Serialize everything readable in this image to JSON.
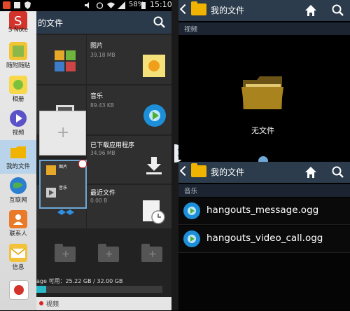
{
  "status_bar": {
    "battery": "58%",
    "time": "15:10"
  },
  "sidebar": {
    "items": [
      {
        "label": "S Note"
      },
      {
        "label": "随附随贴"
      },
      {
        "label": "相册"
      },
      {
        "label": "视频"
      },
      {
        "label": "我的文件",
        "selected": true
      },
      {
        "label": "互联网"
      },
      {
        "label": "联系人"
      },
      {
        "label": "信息"
      }
    ]
  },
  "left_panel": {
    "title": "的文件",
    "categories": [
      {
        "name": "图片",
        "size": "39.18 MB"
      },
      {
        "name": "音乐",
        "size": "89.43 KB"
      },
      {
        "name": "已下载应用程序",
        "size": "34.96 MB"
      },
      {
        "name": "最近文件",
        "size": "0.00 B"
      }
    ],
    "drag_preview": {
      "line1": "图片",
      "line2": "音乐"
    },
    "storage_text": "age 可用：25.22 GB / 32.00 GB",
    "bottom_label": "视频"
  },
  "top_panel": {
    "title": "我的文件",
    "section": "视频",
    "empty_text": "无文件"
  },
  "bottom_panel": {
    "title": "我的文件",
    "section": "音乐",
    "files": [
      {
        "name": "hangouts_message.ogg"
      },
      {
        "name": "hangouts_video_call.ogg"
      }
    ]
  },
  "colors": {
    "accent": "#f0b400",
    "header": "#2c3c4c",
    "divider_knob": "#6fa8d6"
  }
}
